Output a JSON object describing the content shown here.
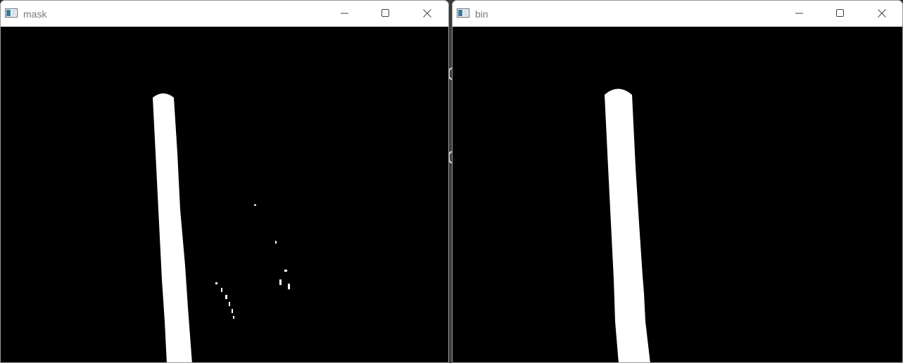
{
  "windows": [
    {
      "title": "mask",
      "icon": "opencv-window-icon",
      "controls": [
        "minimize",
        "maximize",
        "close"
      ]
    },
    {
      "title": "bin",
      "icon": "opencv-window-icon",
      "controls": [
        "minimize",
        "maximize",
        "close"
      ]
    }
  ],
  "colors": {
    "canvas_background": "#000000",
    "foreground_blob": "#ffffff",
    "titlebar_background": "#ffffff",
    "title_text": "#7a7a7a"
  }
}
